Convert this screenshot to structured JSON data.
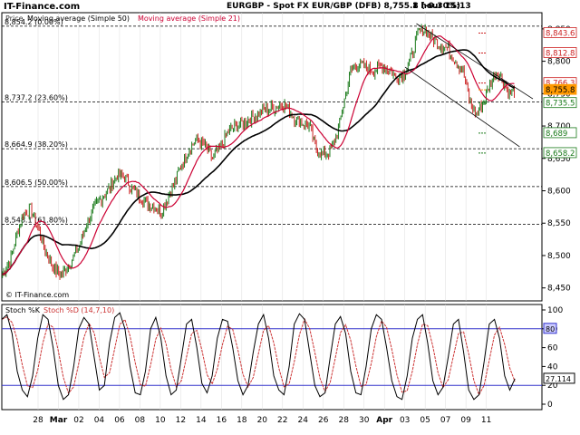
{
  "header": {
    "brand": "IT-Finance.com",
    "title": "EURGBP - Spot FX EUR/GBP (DFB)",
    "last_value": "8,755.8 (-0.30%)",
    "interval": "1 hour",
    "time": "15:13"
  },
  "colors": {
    "price": "#1a7a1a",
    "price_down": "#cc2222",
    "sma50": "#000000",
    "sma21": "#cc0033",
    "fib_line": "#000000",
    "stoch_k": "#000000",
    "stoch_d": "#cc3333",
    "stoch_level": "#3333cc",
    "bg": "#ffffff"
  },
  "chart_data": [
    {
      "type": "line",
      "legend": [
        "Price",
        "Moving average (Simple 50)",
        "Moving average (Simple 21)"
      ],
      "x_ticks": [
        "28",
        "Mar",
        "02",
        "04",
        "06",
        "08",
        "10",
        "12",
        "14",
        "16",
        "18",
        "20",
        "22",
        "24",
        "26",
        "28",
        "30",
        "Apr",
        "03",
        "05",
        "07",
        "09",
        "11"
      ],
      "ylim": [
        8430,
        8875
      ],
      "y_ticks": [
        8450,
        8500,
        8550,
        8600,
        8650,
        8700,
        8750,
        8800,
        8850
      ],
      "y_tick_labels": [
        "8,450",
        "8,500",
        "8,550",
        "8,600",
        "8,650",
        "8,700",
        "8,750",
        "8,800",
        "8,850"
      ],
      "fib_levels": [
        {
          "value": 8854.2,
          "label": "8,854.2 (0.00%)"
        },
        {
          "value": 8737.2,
          "label": "8,737.2 (23.60%)"
        },
        {
          "value": 8664.9,
          "label": "8,664.9 (38.20%)"
        },
        {
          "value": 8606.5,
          "label": "8,606.5 (50.00%)"
        },
        {
          "value": 8548.1,
          "label": "8,548.1 (61.80%)"
        }
      ],
      "right_labels": [
        {
          "value": 8843.6,
          "text": "8,843.6",
          "color": "#cc2222"
        },
        {
          "value": 8812.8,
          "text": "8,812.8",
          "color": "#cc2222"
        },
        {
          "value": 8766.3,
          "text": "8,766.3",
          "color": "#cc2222"
        },
        {
          "value": 8755.8,
          "text": "8,755.8",
          "color": "#ff9900",
          "filled": true
        },
        {
          "value": 8735.5,
          "text": "8,735.5",
          "color": "#1a7a1a"
        },
        {
          "value": 8689.0,
          "text": "8,689",
          "color": "#1a7a1a"
        },
        {
          "value": 8658.2,
          "text": "8,658.2",
          "color": "#1a7a1a"
        }
      ],
      "channel": [
        {
          "x0": 0.808,
          "y0": 8858,
          "x1": 1.0,
          "y1": 8742
        },
        {
          "x0": 0.786,
          "y0": 8791,
          "x1": 0.975,
          "y1": 8668
        }
      ],
      "anchors": [
        [
          0.0,
          8470
        ],
        [
          0.018,
          8500
        ],
        [
          0.03,
          8540
        ],
        [
          0.042,
          8565
        ],
        [
          0.055,
          8572
        ],
        [
          0.068,
          8545
        ],
        [
          0.085,
          8505
        ],
        [
          0.1,
          8480
        ],
        [
          0.115,
          8470
        ],
        [
          0.132,
          8488
        ],
        [
          0.15,
          8515
        ],
        [
          0.165,
          8550
        ],
        [
          0.18,
          8575
        ],
        [
          0.195,
          8590
        ],
        [
          0.21,
          8605
        ],
        [
          0.225,
          8625
        ],
        [
          0.24,
          8620
        ],
        [
          0.255,
          8600
        ],
        [
          0.27,
          8590
        ],
        [
          0.285,
          8580
        ],
        [
          0.3,
          8575
        ],
        [
          0.31,
          8565
        ],
        [
          0.32,
          8585
        ],
        [
          0.335,
          8610
        ],
        [
          0.35,
          8640
        ],
        [
          0.365,
          8665
        ],
        [
          0.38,
          8680
        ],
        [
          0.395,
          8670
        ],
        [
          0.41,
          8650
        ],
        [
          0.425,
          8665
        ],
        [
          0.44,
          8690
        ],
        [
          0.455,
          8700
        ],
        [
          0.47,
          8705
        ],
        [
          0.485,
          8712
        ],
        [
          0.5,
          8720
        ],
        [
          0.515,
          8725
        ],
        [
          0.53,
          8728
        ],
        [
          0.545,
          8735
        ],
        [
          0.555,
          8730
        ],
        [
          0.57,
          8712
        ],
        [
          0.585,
          8705
        ],
        [
          0.6,
          8700
        ],
        [
          0.612,
          8665
        ],
        [
          0.625,
          8655
        ],
        [
          0.64,
          8660
        ],
        [
          0.655,
          8690
        ],
        [
          0.668,
          8740
        ],
        [
          0.68,
          8785
        ],
        [
          0.695,
          8795
        ],
        [
          0.71,
          8790
        ],
        [
          0.725,
          8785
        ],
        [
          0.74,
          8792
        ],
        [
          0.755,
          8788
        ],
        [
          0.77,
          8775
        ],
        [
          0.785,
          8782
        ],
        [
          0.8,
          8810
        ],
        [
          0.812,
          8845
        ],
        [
          0.825,
          8850
        ],
        [
          0.84,
          8835
        ],
        [
          0.855,
          8825
        ],
        [
          0.87,
          8820
        ],
        [
          0.885,
          8800
        ],
        [
          0.9,
          8785
        ],
        [
          0.912,
          8740
        ],
        [
          0.925,
          8718
        ],
        [
          0.94,
          8735
        ],
        [
          0.952,
          8765
        ],
        [
          0.965,
          8785
        ],
        [
          0.978,
          8770
        ],
        [
          0.99,
          8750
        ],
        [
          1.0,
          8755.8
        ]
      ],
      "x_end_fraction": 0.95
    },
    {
      "type": "line",
      "legend": [
        "Stoch %K",
        "Stoch %D (14,7,10)"
      ],
      "ylim": [
        0,
        100
      ],
      "y_ticks": [
        0,
        20,
        40,
        60,
        80,
        100
      ],
      "y_tick_labels": [
        "0",
        "20",
        "40",
        "60",
        "80",
        "100"
      ],
      "levels": [
        20,
        80
      ],
      "level_label": "80",
      "k_value_label": "27.114",
      "k_values": [
        90,
        95,
        75,
        35,
        15,
        8,
        30,
        70,
        95,
        90,
        60,
        20,
        5,
        10,
        40,
        80,
        92,
        85,
        50,
        15,
        20,
        65,
        92,
        97,
        80,
        40,
        12,
        10,
        35,
        80,
        92,
        70,
        30,
        10,
        15,
        50,
        85,
        90,
        60,
        22,
        12,
        30,
        70,
        90,
        88,
        60,
        25,
        10,
        20,
        55,
        85,
        95,
        70,
        30,
        15,
        10,
        40,
        85,
        96,
        90,
        55,
        20,
        8,
        12,
        50,
        85,
        93,
        75,
        35,
        12,
        10,
        40,
        80,
        95,
        90,
        60,
        25,
        8,
        5,
        30,
        70,
        90,
        95,
        65,
        25,
        10,
        18,
        50,
        85,
        90,
        55,
        15,
        5,
        10,
        45,
        85,
        90,
        70,
        30,
        15,
        27
      ]
    }
  ]
}
